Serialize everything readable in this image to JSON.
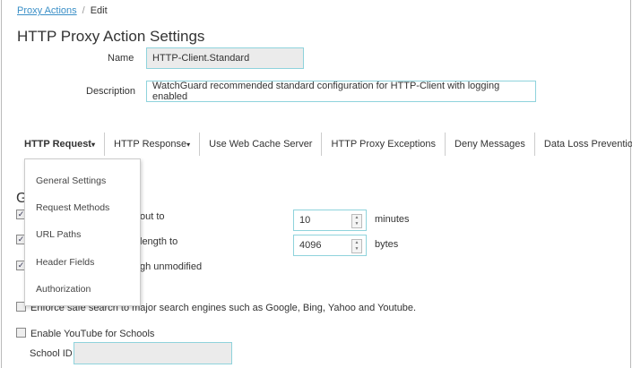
{
  "breadcrumb": {
    "link": "Proxy Actions",
    "separator": "/",
    "current": "Edit"
  },
  "title": "HTTP Proxy Action Settings",
  "form": {
    "name_label": "Name",
    "name_value": "HTTP-Client.Standard",
    "description_label": "Description",
    "description_value": "WatchGuard recommended standard configuration for HTTP-Client with logging enabled"
  },
  "tabs": [
    {
      "label": "HTTP Request",
      "caret": "▾"
    },
    {
      "label": "HTTP Response",
      "caret": "▾"
    },
    {
      "label": "Use Web Cache Server"
    },
    {
      "label": "HTTP Proxy Exceptions"
    },
    {
      "label": "Deny Messages"
    },
    {
      "label": "Data Loss Prevention"
    }
  ],
  "menu": [
    "General Settings",
    "Request Methods",
    "URL Paths",
    "Header Fields",
    "Authorization"
  ],
  "section": {
    "heading_partial": "G",
    "rows": [
      {
        "text_partial": "out to",
        "checked": true,
        "value": "10",
        "unit": "minutes"
      },
      {
        "text_partial": "length to",
        "checked": true,
        "value": "4096",
        "unit": "bytes"
      },
      {
        "text_partial": "gh unmodified",
        "checked": true
      }
    ],
    "safe_search": {
      "label": "Enforce safe search to major search engines such as Google, Bing, Yahoo and Youtube.",
      "checked": false
    },
    "youtube": {
      "label": "Enable YouTube for Schools",
      "checked": false
    },
    "school_id": {
      "label": "School ID",
      "value": ""
    }
  }
}
